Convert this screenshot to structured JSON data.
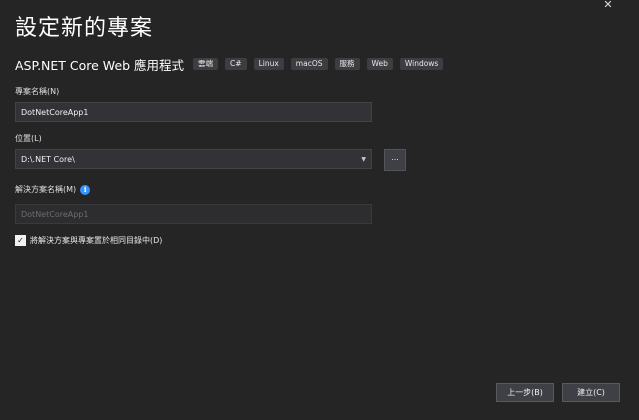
{
  "window": {
    "close_glyph": "✕"
  },
  "page_title": "設定新的專案",
  "project": {
    "type_name": "ASP.NET Core Web 應用程式",
    "tags": [
      "雲端",
      "C#",
      "Linux",
      "macOS",
      "服務",
      "Web",
      "Windows"
    ]
  },
  "project_name": {
    "label": "專案名稱(N)",
    "value": "DotNetCoreApp1"
  },
  "location": {
    "label": "位置(L)",
    "value": "D:\\.NET Core\\",
    "browse_label": "..."
  },
  "solution_name": {
    "label": "解決方案名稱(M)",
    "info_glyph": "i",
    "placeholder": "DotNetCoreApp1"
  },
  "same_directory": {
    "checked": true,
    "check_glyph": "✓",
    "label": "將解決方案與專案置於相同目錄中(D)"
  },
  "footer": {
    "back_label": "上一步(B)",
    "create_label": "建立(C)"
  },
  "colors": {
    "background": "#252526",
    "input_background": "#333337",
    "button_background": "#3f3f46",
    "tag_background": "#3e3e42",
    "info_icon": "#3794ff"
  }
}
